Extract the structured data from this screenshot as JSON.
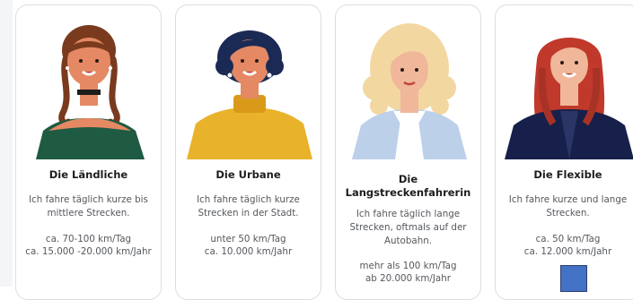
{
  "cards": [
    {
      "title": "Die Ländliche",
      "description": "Ich fahre täglich kurze bis mittlere Strecken.",
      "stat1": "ca. 70-100 km/Tag",
      "stat2": "ca. 15.000 -20.000 km/Jahr"
    },
    {
      "title": "Die Urbane",
      "description": "Ich fahre täglich kurze Strecken in der Stadt.",
      "stat1": "unter 50 km/Tag",
      "stat2": "ca. 10.000 km/Jahr"
    },
    {
      "title": "Die Langstreckenfahrerin",
      "description": "Ich fahre täglich lange Strecken, oftmals auf der Autobahn.",
      "stat1": "mehr als 100 km/Tag",
      "stat2": "ab 20.000 km/Jahr"
    },
    {
      "title": "Die Flexible",
      "description": "Ich fahre kurze und lange Strecken.",
      "stat1": "ca. 50 km/Tag",
      "stat2": "ca. 12.000 km/Jahr"
    }
  ],
  "colors": {
    "card_border": "#dcdde2",
    "title_text": "#1d1d1f",
    "body_text": "#55585d",
    "accent_square": "#4472c4"
  }
}
